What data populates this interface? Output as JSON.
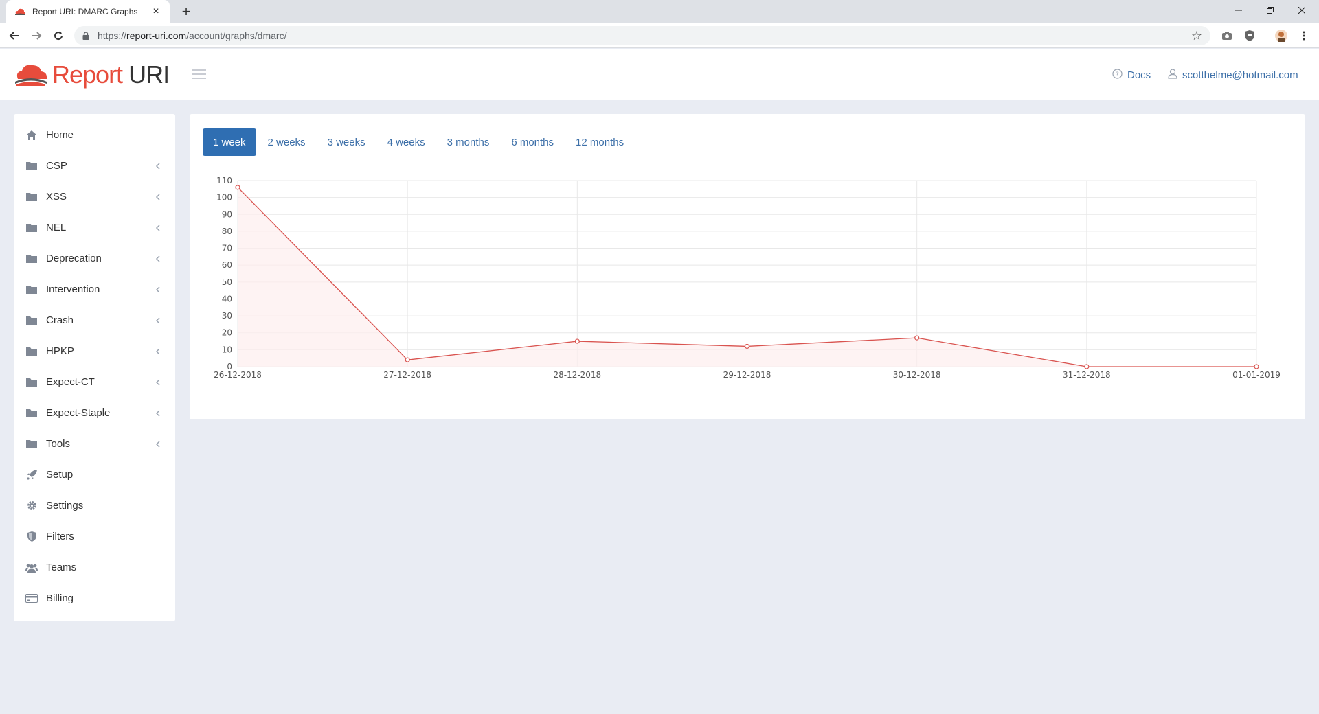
{
  "browser": {
    "tab_title": "Report URI: DMARC Graphs",
    "tab_close": "×",
    "new_tab": "+",
    "url_prefix": "https://",
    "url_host": "report-uri.com",
    "url_path": "/account/graphs/dmarc/"
  },
  "header": {
    "logo_word1": "Report",
    "logo_word2": "URI",
    "docs_label": "Docs",
    "user_email": "scotthelme@hotmail.com",
    "accent_color": "#e74c3c"
  },
  "sidebar": {
    "items": [
      {
        "label": "Home",
        "icon": "home-icon",
        "expandable": false
      },
      {
        "label": "CSP",
        "icon": "folder-icon",
        "expandable": true
      },
      {
        "label": "XSS",
        "icon": "folder-icon",
        "expandable": true
      },
      {
        "label": "NEL",
        "icon": "folder-icon",
        "expandable": true
      },
      {
        "label": "Deprecation",
        "icon": "folder-icon",
        "expandable": true
      },
      {
        "label": "Intervention",
        "icon": "folder-icon",
        "expandable": true
      },
      {
        "label": "Crash",
        "icon": "folder-icon",
        "expandable": true
      },
      {
        "label": "HPKP",
        "icon": "folder-icon",
        "expandable": true
      },
      {
        "label": "Expect-CT",
        "icon": "folder-icon",
        "expandable": true
      },
      {
        "label": "Expect-Staple",
        "icon": "folder-icon",
        "expandable": true
      },
      {
        "label": "Tools",
        "icon": "folder-icon",
        "expandable": true
      },
      {
        "label": "Setup",
        "icon": "rocket-icon",
        "expandable": false
      },
      {
        "label": "Settings",
        "icon": "gear-icon",
        "expandable": false
      },
      {
        "label": "Filters",
        "icon": "shield-icon",
        "expandable": false
      },
      {
        "label": "Teams",
        "icon": "users-icon",
        "expandable": false
      },
      {
        "label": "Billing",
        "icon": "credit-card-icon",
        "expandable": false
      }
    ]
  },
  "range_tabs": {
    "active_index": 0,
    "items": [
      "1 week",
      "2 weeks",
      "3 weeks",
      "4 weeks",
      "3 months",
      "6 months",
      "12 months"
    ]
  },
  "chart_data": {
    "type": "line",
    "categories": [
      "26-12-2018",
      "27-12-2018",
      "28-12-2018",
      "29-12-2018",
      "30-12-2018",
      "31-12-2018",
      "01-01-2019"
    ],
    "values": [
      106,
      4,
      15,
      12,
      17,
      0,
      0
    ],
    "ylim": [
      0,
      110
    ],
    "yticks": [
      0,
      10,
      20,
      30,
      40,
      50,
      60,
      70,
      80,
      90,
      100,
      110
    ],
    "grid": true,
    "line_color": "#d9534f",
    "fill_color": "#fdeeee"
  }
}
